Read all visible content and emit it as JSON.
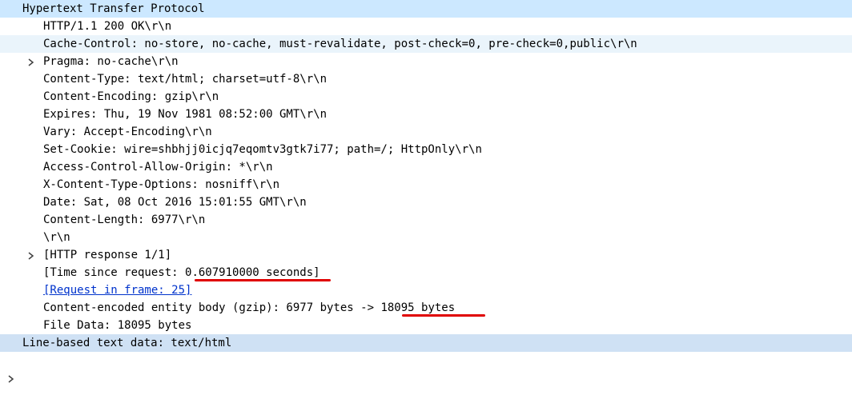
{
  "tree": {
    "root_label": "Hypertext Transfer Protocol",
    "status_line": "HTTP/1.1 200 OK\\r\\n",
    "headers": [
      "Cache-Control: no-store, no-cache, must-revalidate, post-check=0, pre-check=0,public\\r\\n",
      "Pragma: no-cache\\r\\n",
      "Content-Type: text/html; charset=utf-8\\r\\n",
      "Content-Encoding: gzip\\r\\n",
      "Expires: Thu, 19 Nov 1981 08:52:00 GMT\\r\\n",
      "Vary: Accept-Encoding\\r\\n",
      "Set-Cookie: wire=shbhjj0icjq7eqomtv3gtk7i77; path=/; HttpOnly\\r\\n",
      "Access-Control-Allow-Origin: *\\r\\n",
      "X-Content-Type-Options: nosniff\\r\\n",
      "Date: Sat, 08 Oct 2016 15:01:55 GMT\\r\\n"
    ],
    "content_length": "Content-Length: 6977\\r\\n",
    "blank_line": "\\r\\n",
    "http_response": "[HTTP response 1/1]",
    "time_since_prefix": "[Time since request: ",
    "time_since_value": "0.607910000 seconds",
    "time_since_suffix": "]",
    "request_in_frame": "[Request in frame: 25]",
    "encoded_prefix": "Content-encoded entity body (gzip): 6977 bytes -> ",
    "encoded_value": "18095 bytes",
    "file_data": "File Data: 18095 bytes",
    "line_based": "Line-based text data: text/html"
  },
  "colors": {
    "selection": "#cce8ff",
    "header_row": "#cfe1f4",
    "highlight_row": "#eaf4fb",
    "link": "#0033cc",
    "annotation": "#e00000"
  },
  "icons": {
    "expanded": "chevron-down-icon",
    "collapsed": "chevron-right-icon"
  }
}
